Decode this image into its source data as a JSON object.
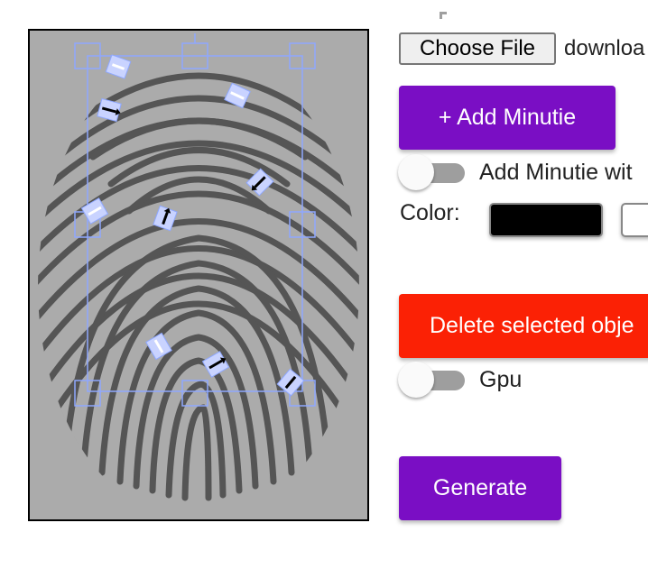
{
  "file_input": {
    "button_label": "Choose File",
    "file_name": "downloa"
  },
  "add_minutie_button": {
    "label": "+ Add Minutie"
  },
  "add_minutie_toggle": {
    "label": "Add Minutie wit",
    "checked": false
  },
  "color_picker": {
    "label": "Color:",
    "options": [
      {
        "name": "black",
        "color": "#000000"
      },
      {
        "name": "white",
        "color": "#ffffff"
      }
    ]
  },
  "delete_button": {
    "label": "Delete selected obje"
  },
  "gpu_toggle": {
    "label": "Gpu",
    "checked": false
  },
  "generate_button": {
    "label": "Generate"
  },
  "colors": {
    "primary": "#7a0ec4",
    "danger": "#fb2105",
    "canvas_background": "#ababab",
    "ridge": "#555555",
    "selection": "#8fa8ff"
  },
  "canvas": {
    "icon": "fingerprint-image",
    "minutiae_count": 10
  }
}
